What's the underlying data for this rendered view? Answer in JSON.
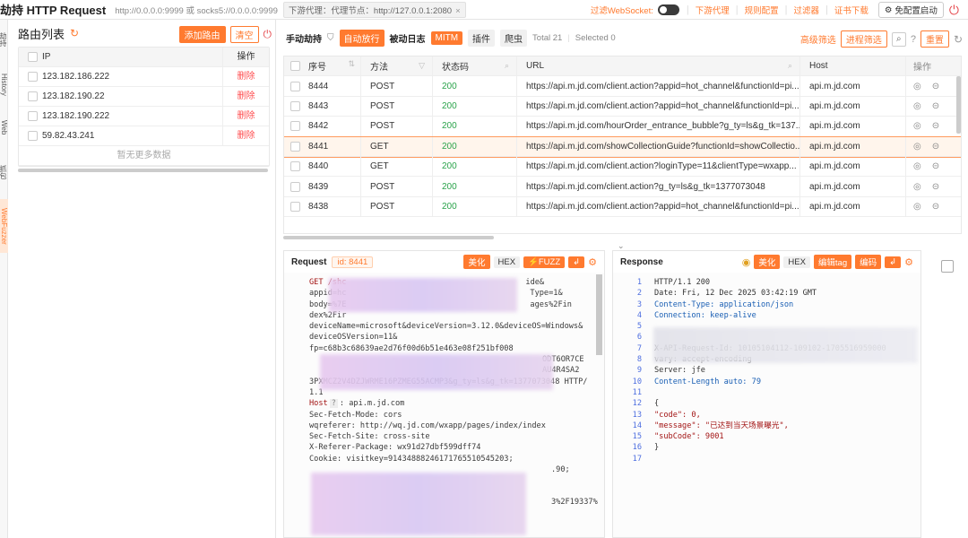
{
  "topbar": {
    "title": "劫持 HTTP Request",
    "listen": "http://0.0.0.0:9999 或 socks5://0.0.0.0:9999",
    "proxy": "下游代理：代理节点：http://127.0.0.1:2080",
    "proxy_close": "×",
    "filter_ws": "过滤WebSocket:",
    "downstream": "下游代理",
    "rules": "规则配置",
    "filter": "过滤器",
    "cert": "证书下载",
    "free_start": "免配置启动"
  },
  "sidetabs": [
    "劫持",
    "History",
    "Web Fuzzer",
    "抓包",
    "WebFuzzer"
  ],
  "left": {
    "title": "路由列表",
    "add_route": "添加路由",
    "clear": "清空",
    "col_ip": "IP",
    "col_op": "操作",
    "rows": [
      {
        "ip": "123.182.186.222",
        "op": "删除"
      },
      {
        "ip": "123.182.190.22",
        "op": "删除"
      },
      {
        "ip": "123.182.190.222",
        "op": "删除"
      },
      {
        "ip": "59.82.43.241",
        "op": "删除"
      }
    ],
    "no_more": "暂无更多数据"
  },
  "toolbar": {
    "manual": "手动劫持",
    "auto_release": "自动放行",
    "passive_log": "被动日志",
    "mitm": "MITM",
    "plugin": "插件",
    "crawler": "爬虫",
    "total": "Total 21",
    "selected": "Selected 0",
    "advanced_filter": "高级筛选",
    "process_filter": "进程筛选",
    "reset": "重置"
  },
  "table": {
    "headers": {
      "id": "序号",
      "method": "方法",
      "status": "状态码",
      "url": "URL",
      "host": "Host",
      "op": "操作"
    },
    "rows": [
      {
        "id": "8444",
        "method": "POST",
        "status": "200",
        "url": "https://api.m.jd.com/client.action?appid=hot_channel&functionId=pi...",
        "host": "api.m.jd.com"
      },
      {
        "id": "8443",
        "method": "POST",
        "status": "200",
        "url": "https://api.m.jd.com/client.action?appid=hot_channel&functionId=pi...",
        "host": "api.m.jd.com"
      },
      {
        "id": "8442",
        "method": "POST",
        "status": "200",
        "url": "https://api.m.jd.com/hourOrder_entrance_bubble?g_ty=ls&g_tk=137...",
        "host": "api.m.jd.com"
      },
      {
        "id": "8441",
        "method": "GET",
        "status": "200",
        "url": "https://api.m.jd.com/showCollectionGuide?functionId=showCollectio...",
        "host": "api.m.jd.com"
      },
      {
        "id": "8440",
        "method": "GET",
        "status": "200",
        "url": "https://api.m.jd.com/client.action?loginType=11&clientType=wxapp...",
        "host": "api.m.jd.com"
      },
      {
        "id": "8439",
        "method": "POST",
        "status": "200",
        "url": "https://api.m.jd.com/client.action?g_ty=ls&g_tk=1377073048",
        "host": "api.m.jd.com"
      },
      {
        "id": "8438",
        "method": "POST",
        "status": "200",
        "url": "https://api.m.jd.com/client.action?appid=hot_channel&functionId=pi...",
        "host": "api.m.jd.com"
      }
    ]
  },
  "request": {
    "title": "Request",
    "id": "id: 8441",
    "beautify": "美化",
    "hex": "HEX",
    "fuzz": "⚡FUZZ",
    "lines": {
      "l1": "GET /shc",
      "l1b": "ide&",
      "l2": "appid=hc",
      "l2b": "Type=1&",
      "l3": "body=%7E",
      "l3b": "ages%2Fin",
      "l4": "dex%2Fir",
      "l5": "deviceName=microsoft&deviceVersion=3.12.0&deviceOS=Windows&",
      "l6": "deviceOSVersion=11&",
      "l7": "fp=c68b3c68639ae2d76f00d6b51e463e08f251bf008",
      "l8": "ODT6OR7CE",
      "l9": "AU4R4SA2",
      "l10": "3PXMCZ2V4DZJWRME16PZMEG55ACMP3&g_ty=ls&g_tk=1377073048 HTTP/",
      "l11": "1.1",
      "host_key": "Host",
      "host_val": ": api.m.jd.com",
      "l13": "Sec-Fetch-Mode: cors",
      "l14": "wqreferer: http://wq.jd.com/wxapp/pages/index/index",
      "l15": "Sec-Fetch-Site: cross-site",
      "l16": "X-Referer-Package: wx91d27dbf599dff74",
      "l17": "Cookie: visitkey=914348882461717655105452​03;",
      "l18": ".90;",
      "l19": "3%2F19337%"
    }
  },
  "response": {
    "title": "Response",
    "beautify": "美化",
    "hex": "HEX",
    "edit_tag": "编辑tag",
    "encode": "编码",
    "lines": [
      {
        "n": "1",
        "t": "HTTP/1.1 200"
      },
      {
        "n": "2",
        "t": "Date: Fri, 12 Dec 2025 03:42:19 GMT"
      },
      {
        "n": "3",
        "t": "Content-Type: application/json"
      },
      {
        "n": "4",
        "t": "Connection: keep-alive"
      },
      {
        "n": "5",
        "t": ""
      },
      {
        "n": "6",
        "t": ""
      },
      {
        "n": "7",
        "t": "X-API-Request-Id: 10105104112-109102-1705516959000"
      },
      {
        "n": "8",
        "t": "vary: accept-encoding"
      },
      {
        "n": "9",
        "t": "Server: jfe"
      },
      {
        "n": "10",
        "t": "Content-Length auto: 79"
      },
      {
        "n": "11",
        "t": ""
      },
      {
        "n": "12",
        "t": "{"
      },
      {
        "n": "13",
        "t": "  \"code\": 0,"
      },
      {
        "n": "14",
        "t": "  \"message\": \"已达到当天场景曝光\","
      },
      {
        "n": "15",
        "t": "  \"subCode\": 9001"
      },
      {
        "n": "16",
        "t": "}"
      },
      {
        "n": "17",
        "t": ""
      }
    ]
  }
}
